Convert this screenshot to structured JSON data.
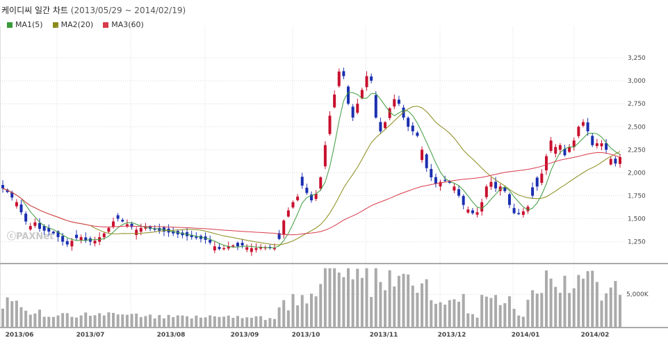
{
  "title": {
    "name": "케이디씨 일간 차트",
    "range": "(2013/05/29 ~ 2014/02/19)"
  },
  "legend": [
    {
      "label": "MA1(5)",
      "color": "#3a9a3a"
    },
    {
      "label": "MA2(20)",
      "color": "#8a8a1a"
    },
    {
      "label": "MA3(60)",
      "color": "#d83a4a"
    }
  ],
  "watermark": "ⓒPAXNet",
  "colors": {
    "up": "#c8102e",
    "down": "#1a2fb0",
    "volume": "#aaaaaa",
    "grid": "#d8d8d8"
  },
  "chart_data": {
    "type": "candlestick",
    "x_labels": [
      "2013/06",
      "2013/07",
      "2013/08",
      "2013/09",
      "2013/10",
      "2013/11",
      "2013/12",
      "2014/01",
      "2014/02"
    ],
    "price_axis": {
      "ticks": [
        "1,250",
        "1,500",
        "1,750",
        "2,000",
        "2,250",
        "2,500",
        "2,750",
        "3,000",
        "3,250"
      ],
      "tick_values": [
        1250,
        1500,
        1750,
        2000,
        2250,
        2500,
        2750,
        3000,
        3250
      ],
      "range": [
        1020,
        3500
      ]
    },
    "volume_axis": {
      "ticks": [
        "5,000K"
      ],
      "tick_values": [
        5000
      ],
      "range": [
        0,
        9400
      ]
    },
    "ma_periods": [
      5,
      20,
      60
    ],
    "close": [
      1830,
      1790,
      1730,
      1680,
      1570,
      1470,
      1420,
      1460,
      1390,
      1370,
      1360,
      1340,
      1300,
      1250,
      1220,
      1260,
      1290,
      1300,
      1260,
      1250,
      1260,
      1300,
      1340,
      1400,
      1470,
      1500,
      1470,
      1440,
      1410,
      1380,
      1400,
      1410,
      1390,
      1380,
      1370,
      1360,
      1350,
      1340,
      1330,
      1320,
      1310,
      1300,
      1290,
      1280,
      1270,
      1240,
      1200,
      1170,
      1180,
      1200,
      1210,
      1200,
      1210,
      1190,
      1180,
      1180,
      1190,
      1190,
      1180,
      1180,
      1280,
      1480,
      1590,
      1680,
      1740,
      1860,
      1780,
      1700,
      1770,
      1950,
      2300,
      2620,
      2850,
      3100,
      3050,
      2750,
      2600,
      2750,
      2900,
      3050,
      3000,
      2600,
      2450,
      2550,
      2700,
      2800,
      2750,
      2600,
      2500,
      2450,
      2400,
      2250,
      2050,
      1950,
      1880,
      1900,
      1910,
      1890,
      1850,
      1750,
      1650,
      1600,
      1560,
      1570,
      1680,
      1850,
      1900,
      1830,
      1850,
      1800,
      1650,
      1560,
      1550,
      1580,
      1630,
      1750,
      1850,
      1990,
      2180,
      2350,
      2280,
      2300,
      2190,
      2280,
      2350,
      2500,
      2550,
      2450,
      2300,
      2320,
      2320,
      2250,
      2150,
      2100,
      2170
    ]
  }
}
